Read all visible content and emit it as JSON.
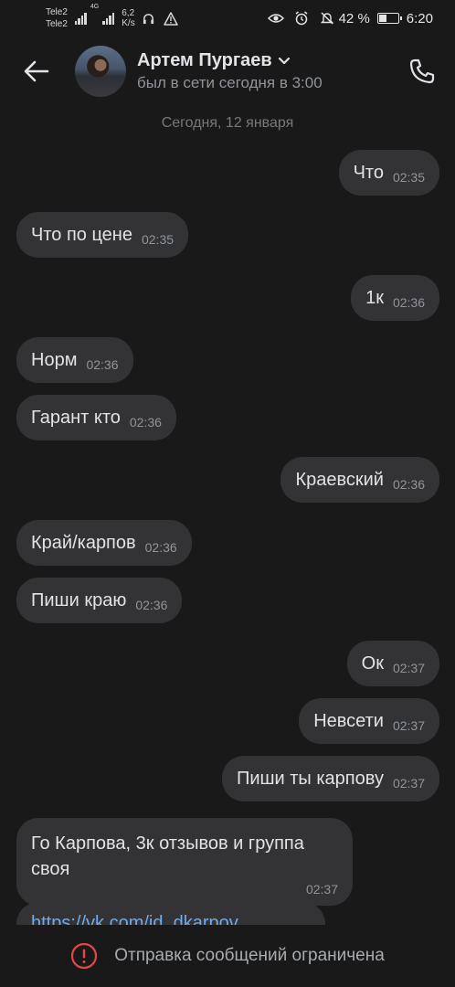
{
  "status_bar": {
    "carrier1": "Tele2",
    "carrier2": "Tele2",
    "network_type": "4G",
    "speed_value": "6,2",
    "speed_unit": "K/s",
    "battery_percent": "42 %",
    "battery_level": 0.42,
    "time": "6:20"
  },
  "header": {
    "contact_name": "Артем Пургаев",
    "contact_status": "был в сети сегодня в 3:00"
  },
  "date_separator": "Сегодня, 12 января",
  "messages": [
    {
      "direction": "out",
      "text": "Что",
      "time": "02:35"
    },
    {
      "direction": "in",
      "text": "Что по цене",
      "time": "02:35"
    },
    {
      "direction": "out",
      "text": "1к",
      "time": "02:36"
    },
    {
      "direction": "in",
      "text": "Норм",
      "time": "02:36"
    },
    {
      "direction": "in",
      "text": "Гарант кто",
      "time": "02:36"
    },
    {
      "direction": "out",
      "text": "Краевский",
      "time": "02:36"
    },
    {
      "direction": "in",
      "text": "Край/карпов",
      "time": "02:36"
    },
    {
      "direction": "in",
      "text": "Пиши краю",
      "time": "02:36"
    },
    {
      "direction": "out",
      "text": "Ок",
      "time": "02:37"
    },
    {
      "direction": "out",
      "text": "Невсети",
      "time": "02:37"
    },
    {
      "direction": "out",
      "text": "Пиши ты карпову",
      "time": "02:37"
    },
    {
      "direction": "in",
      "text": "Го Карпова, 3к отзывов и группа своя",
      "time": "02:37"
    },
    {
      "direction": "in",
      "text": "https://vk.com/id_dkarpov",
      "time": ""
    }
  ],
  "bottom_bar": {
    "restricted_text": "Отправка сообщений ограничена"
  },
  "colors": {
    "background": "#19191a",
    "bubble": "#333336",
    "accent": "#71aaeb",
    "warning": "#e64646"
  }
}
